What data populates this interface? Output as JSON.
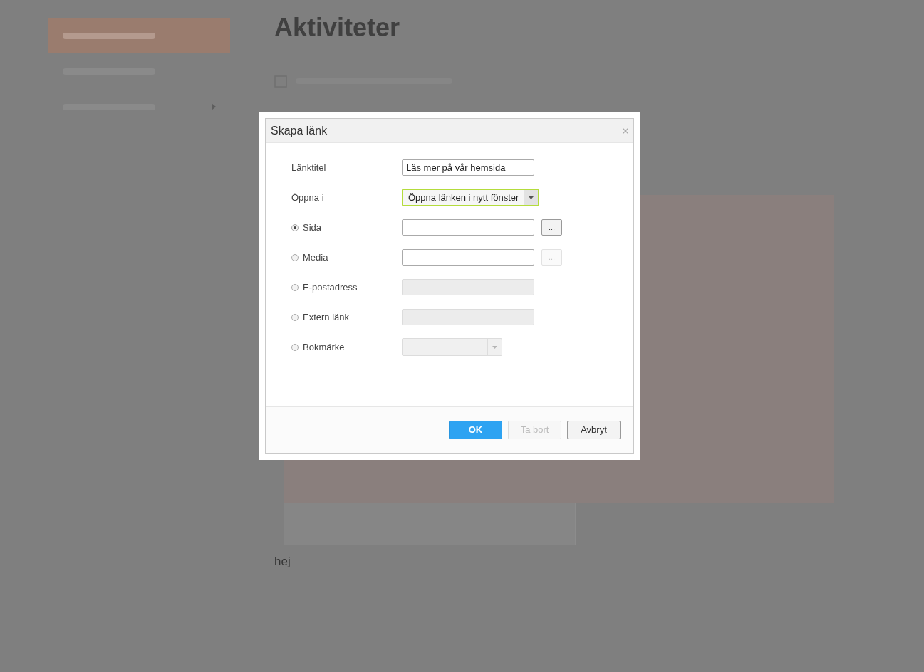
{
  "page": {
    "sidebar": [
      {
        "selected": true,
        "has_submenu": false
      },
      {
        "selected": false,
        "has_submenu": false
      },
      {
        "selected": false,
        "has_submenu": true
      }
    ],
    "heading": "Aktiviteter",
    "editor_text": "hej"
  },
  "dialog": {
    "title": "Skapa länk",
    "fields": [
      {
        "kind": "text",
        "label": "Länktitel",
        "value": "Läs mer på vår hemsida"
      },
      {
        "kind": "select",
        "label": "Öppna i",
        "value": "Öppna länken i nytt fönster",
        "focused": true
      }
    ],
    "options": [
      {
        "label": "Sida",
        "selected": true,
        "kind": "input",
        "disabled": false,
        "browse": {
          "label": "...",
          "disabled": false
        }
      },
      {
        "label": "Media",
        "selected": false,
        "kind": "input",
        "disabled": false,
        "browse": {
          "label": "...",
          "disabled": true
        }
      },
      {
        "label": "E-postadress",
        "selected": false,
        "kind": "input",
        "disabled": true
      },
      {
        "label": "Extern länk",
        "selected": false,
        "kind": "input",
        "disabled": true
      },
      {
        "label": "Bokmärke",
        "selected": false,
        "kind": "select",
        "disabled": true
      }
    ],
    "buttons": [
      {
        "label": "OK",
        "kind": "primary",
        "disabled": false
      },
      {
        "label": "Ta bort",
        "kind": "secondary",
        "disabled": true
      },
      {
        "label": "Avbryt",
        "kind": "secondary",
        "disabled": false
      }
    ]
  }
}
